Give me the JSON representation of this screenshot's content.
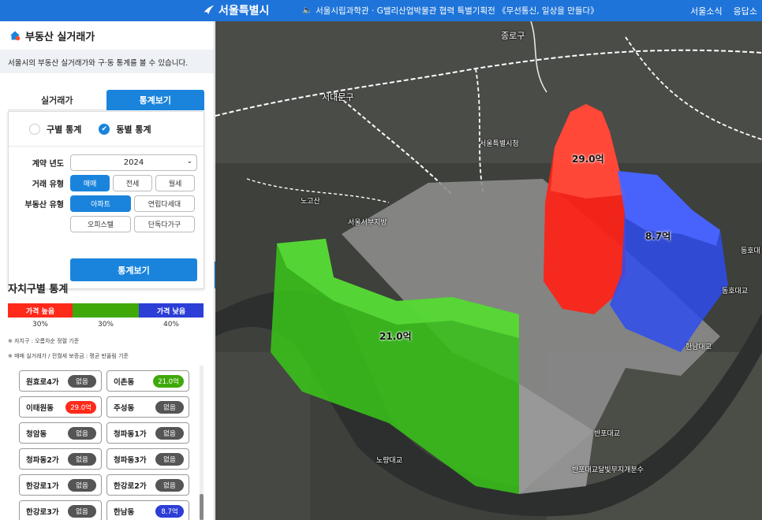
{
  "header": {
    "logo_text": "서울특별시",
    "notice_text": "서울시립과학관 · G밸리산업박물관 협력 특별기획전 《무선통신, 일상을 만들다》",
    "nav": [
      "서울소식",
      "응답소"
    ]
  },
  "sidebar": {
    "title": "부동산 실거래가",
    "description": "서울시의 부동산 실거래가와 구·동 통계를 볼 수 있습니다.",
    "tabs": [
      "실거래가",
      "통계보기"
    ],
    "radio_options": [
      "구별 통계",
      "동별 통계"
    ],
    "year_label": "계약 년도",
    "year_value": "2024",
    "trade_type_label": "거래 유형",
    "trade_types": [
      "매매",
      "전세",
      "월세"
    ],
    "property_type_label": "부동산 유형",
    "property_types": [
      "아파트",
      "연립다세대",
      "오피스텔",
      "단독다가구"
    ],
    "stats_button": "통계보기",
    "section_title": "자치구별 통계",
    "legend": {
      "high": "가격 높음",
      "low": "가격 낮음",
      "pcts": [
        "30%",
        "30%",
        "40%"
      ]
    },
    "notes": [
      "※ 자치구 : 오름차순 정렬 기준",
      "※ 매매 실거래가 / 전월세 보증금 : 평균 반올림 기준"
    ],
    "dong_items": [
      {
        "name": "원효로4가",
        "value": "없음"
      },
      {
        "name": "이촌동",
        "value": "21.0억"
      },
      {
        "name": "이태원동",
        "value": "29.0억"
      },
      {
        "name": "주성동",
        "value": "없음"
      },
      {
        "name": "청암동",
        "value": "없음"
      },
      {
        "name": "청파동1가",
        "value": "없음"
      },
      {
        "name": "청파동2가",
        "value": "없음"
      },
      {
        "name": "청파동3가",
        "value": "없음"
      },
      {
        "name": "한강로1가",
        "value": "없음"
      },
      {
        "name": "한강로2가",
        "value": "없음"
      },
      {
        "name": "한강로3가",
        "value": "없음"
      },
      {
        "name": "한남동",
        "value": "8.7억"
      }
    ]
  },
  "colors": {
    "accent": "#1a84dc",
    "high": "#ff2a1a",
    "mid": "#3fa90a",
    "low": "#2c3ed6",
    "none": "#555555"
  },
  "map": {
    "labels": [
      "종로구",
      "서대문구",
      "서울특별시청",
      "노고산",
      "서울서부지방",
      "동호대교",
      "한남대교",
      "반포대교",
      "반포대교달빛무지개분수",
      "동호대",
      "노량대교"
    ],
    "prices": [
      "29.0억",
      "8.7억",
      "21.0억"
    ]
  }
}
